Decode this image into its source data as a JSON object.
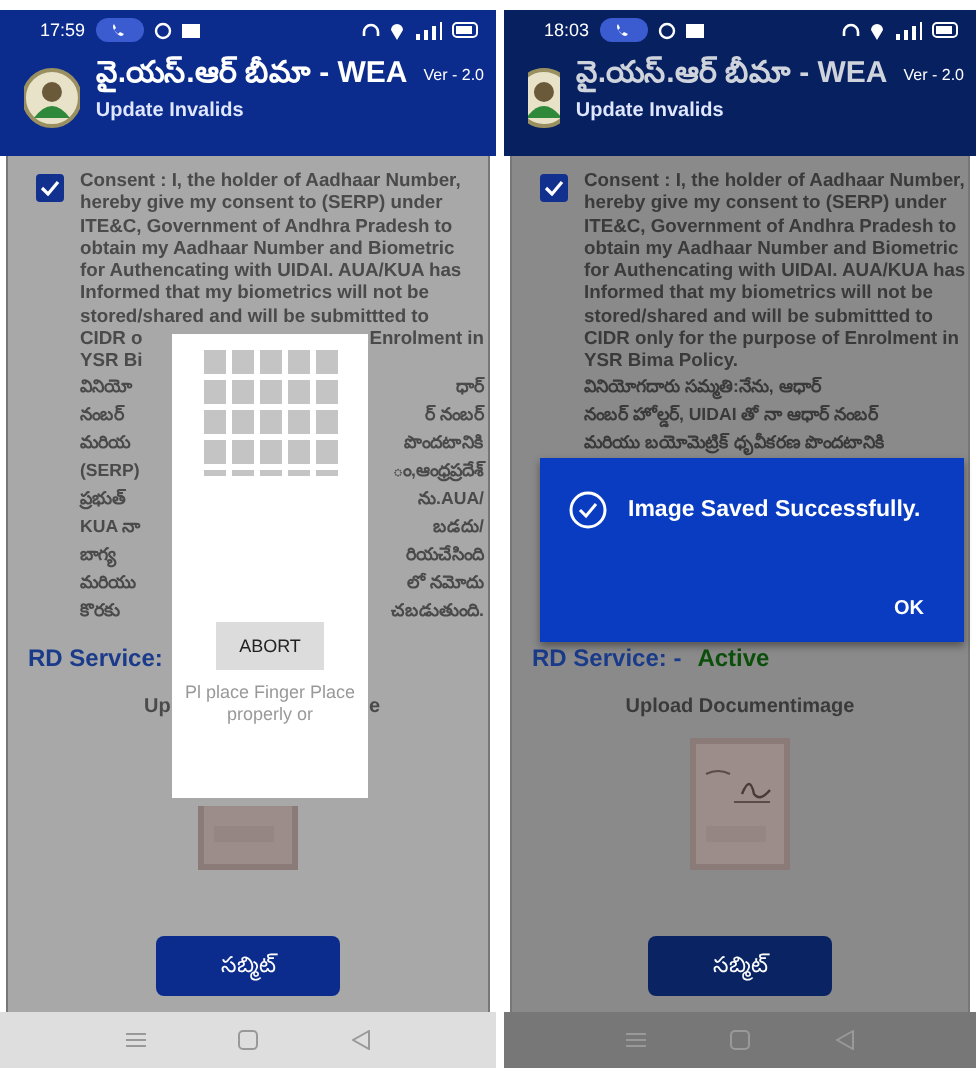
{
  "screens": [
    {
      "status_bar": {
        "time": "17:59"
      },
      "app_bar": {
        "title": "వై.యస్.ఆర్ బీమా - WEA",
        "subtitle": "Update Invalids",
        "version": "Ver - 2.0"
      },
      "consent": {
        "checked": true,
        "lines": [
          {
            "left": "Consent : I, the holder of Aadhaar Number,"
          },
          {
            "left": "hereby give my consent to (SERP) under"
          },
          {
            "left": "ITE&C, Government of Andhra Pradesh to"
          },
          {
            "left": "obtain my Aadhaar Number and Biometric"
          },
          {
            "left": "for Authencating with UIDAI. AUA/KUA has"
          },
          {
            "left": "Informed that my biometrics will not be"
          },
          {
            "left": "stored/shared and will be submittted to"
          },
          {
            "left": "CIDR o",
            "right": "Enrolment in"
          },
          {
            "left": "YSR Bi"
          },
          {
            "left": "వినియో",
            "right": "ధార్"
          },
          {
            "left": "నంబర్",
            "right": "ర్ నంబర్"
          },
          {
            "left": "మరియ",
            "right": "పొందటానికి"
          },
          {
            "left": "(SERP)",
            "right": "ం,ఆంధ్రప్రదేశ్"
          },
          {
            "left": "ప్రభుత్",
            "right": "ను.AUA/"
          },
          {
            "left": "KUA నా",
            "right": "బడదు/"
          },
          {
            "left": "బాగ్య",
            "right": "రియచేసింది"
          },
          {
            "left": "మరియు",
            "right": "లో నమోదు"
          },
          {
            "left": "కొరకు",
            "right": "చబడుతుంది."
          }
        ]
      },
      "rd_service": {
        "label": "RD Service:"
      },
      "upload": {
        "left": "Up",
        "right": "e"
      },
      "submit": "సబ్మిట్",
      "dialog": {
        "kind": "fingerprint",
        "button": "ABORT",
        "message": "Pl place Finger Place properly or"
      }
    },
    {
      "status_bar": {
        "time": "18:03"
      },
      "app_bar": {
        "title": "వై.యస్.ఆర్ బీమా - WEA",
        "subtitle": "Update Invalids",
        "version": "Ver - 2.0"
      },
      "consent": {
        "checked": true,
        "lines": [
          {
            "left": "Consent : I, the holder of Aadhaar Number,"
          },
          {
            "left": "hereby give my consent to (SERP) under"
          },
          {
            "left": "ITE&C, Government of Andhra Pradesh to"
          },
          {
            "left": "obtain my Aadhaar Number and Biometric"
          },
          {
            "left": "for Authencating with UIDAI. AUA/KUA has"
          },
          {
            "left": "Informed that my biometrics will not be"
          },
          {
            "left": "stored/shared and will be submittted to"
          },
          {
            "left": "CIDR only for the purpose of Enrolment in"
          },
          {
            "left": "YSR Bima Policy."
          },
          {
            "left": "వినియోగదారు సమ్మతి:నేను, ఆధార్"
          },
          {
            "left": "నంబర్ హోల్డర్, UIDAI తో నా ఆధార్ నంబర్"
          },
          {
            "left": "మరియు బయోమెట్రిక్ ధృవీకరణ పొందటానికి"
          }
        ]
      },
      "rd_service": {
        "label": "RD Service: -",
        "status": "Active"
      },
      "upload": {
        "left": "Upload Documentimage"
      },
      "submit": "సబ్మిట్",
      "dialog": {
        "kind": "alert",
        "message": "Image Saved Successfully.",
        "button": "OK"
      }
    }
  ]
}
